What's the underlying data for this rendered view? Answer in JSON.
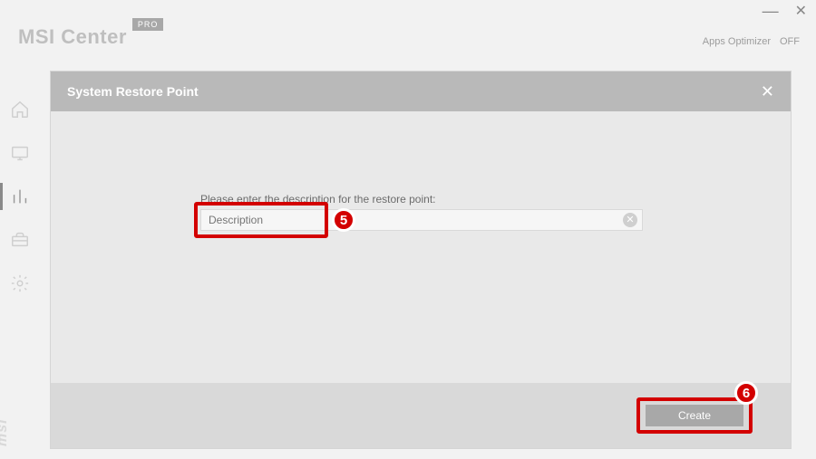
{
  "window": {
    "brand": "MSI Center",
    "badge": "PRO",
    "mark": "msi"
  },
  "top_right": {
    "apps_optimizer_label": "Apps Optimizer",
    "toggle_state": "OFF"
  },
  "sidenav": {
    "items": [
      {
        "name": "home"
      },
      {
        "name": "monitor"
      },
      {
        "name": "stats",
        "active": true
      },
      {
        "name": "toolbox"
      },
      {
        "name": "settings"
      }
    ]
  },
  "dialog": {
    "title": "System Restore Point",
    "prompt": "Please enter the description for the restore point:",
    "description_placeholder": "Description",
    "description_value": "",
    "create_label": "Create"
  },
  "annotations": {
    "step5": "5",
    "step6": "6"
  }
}
